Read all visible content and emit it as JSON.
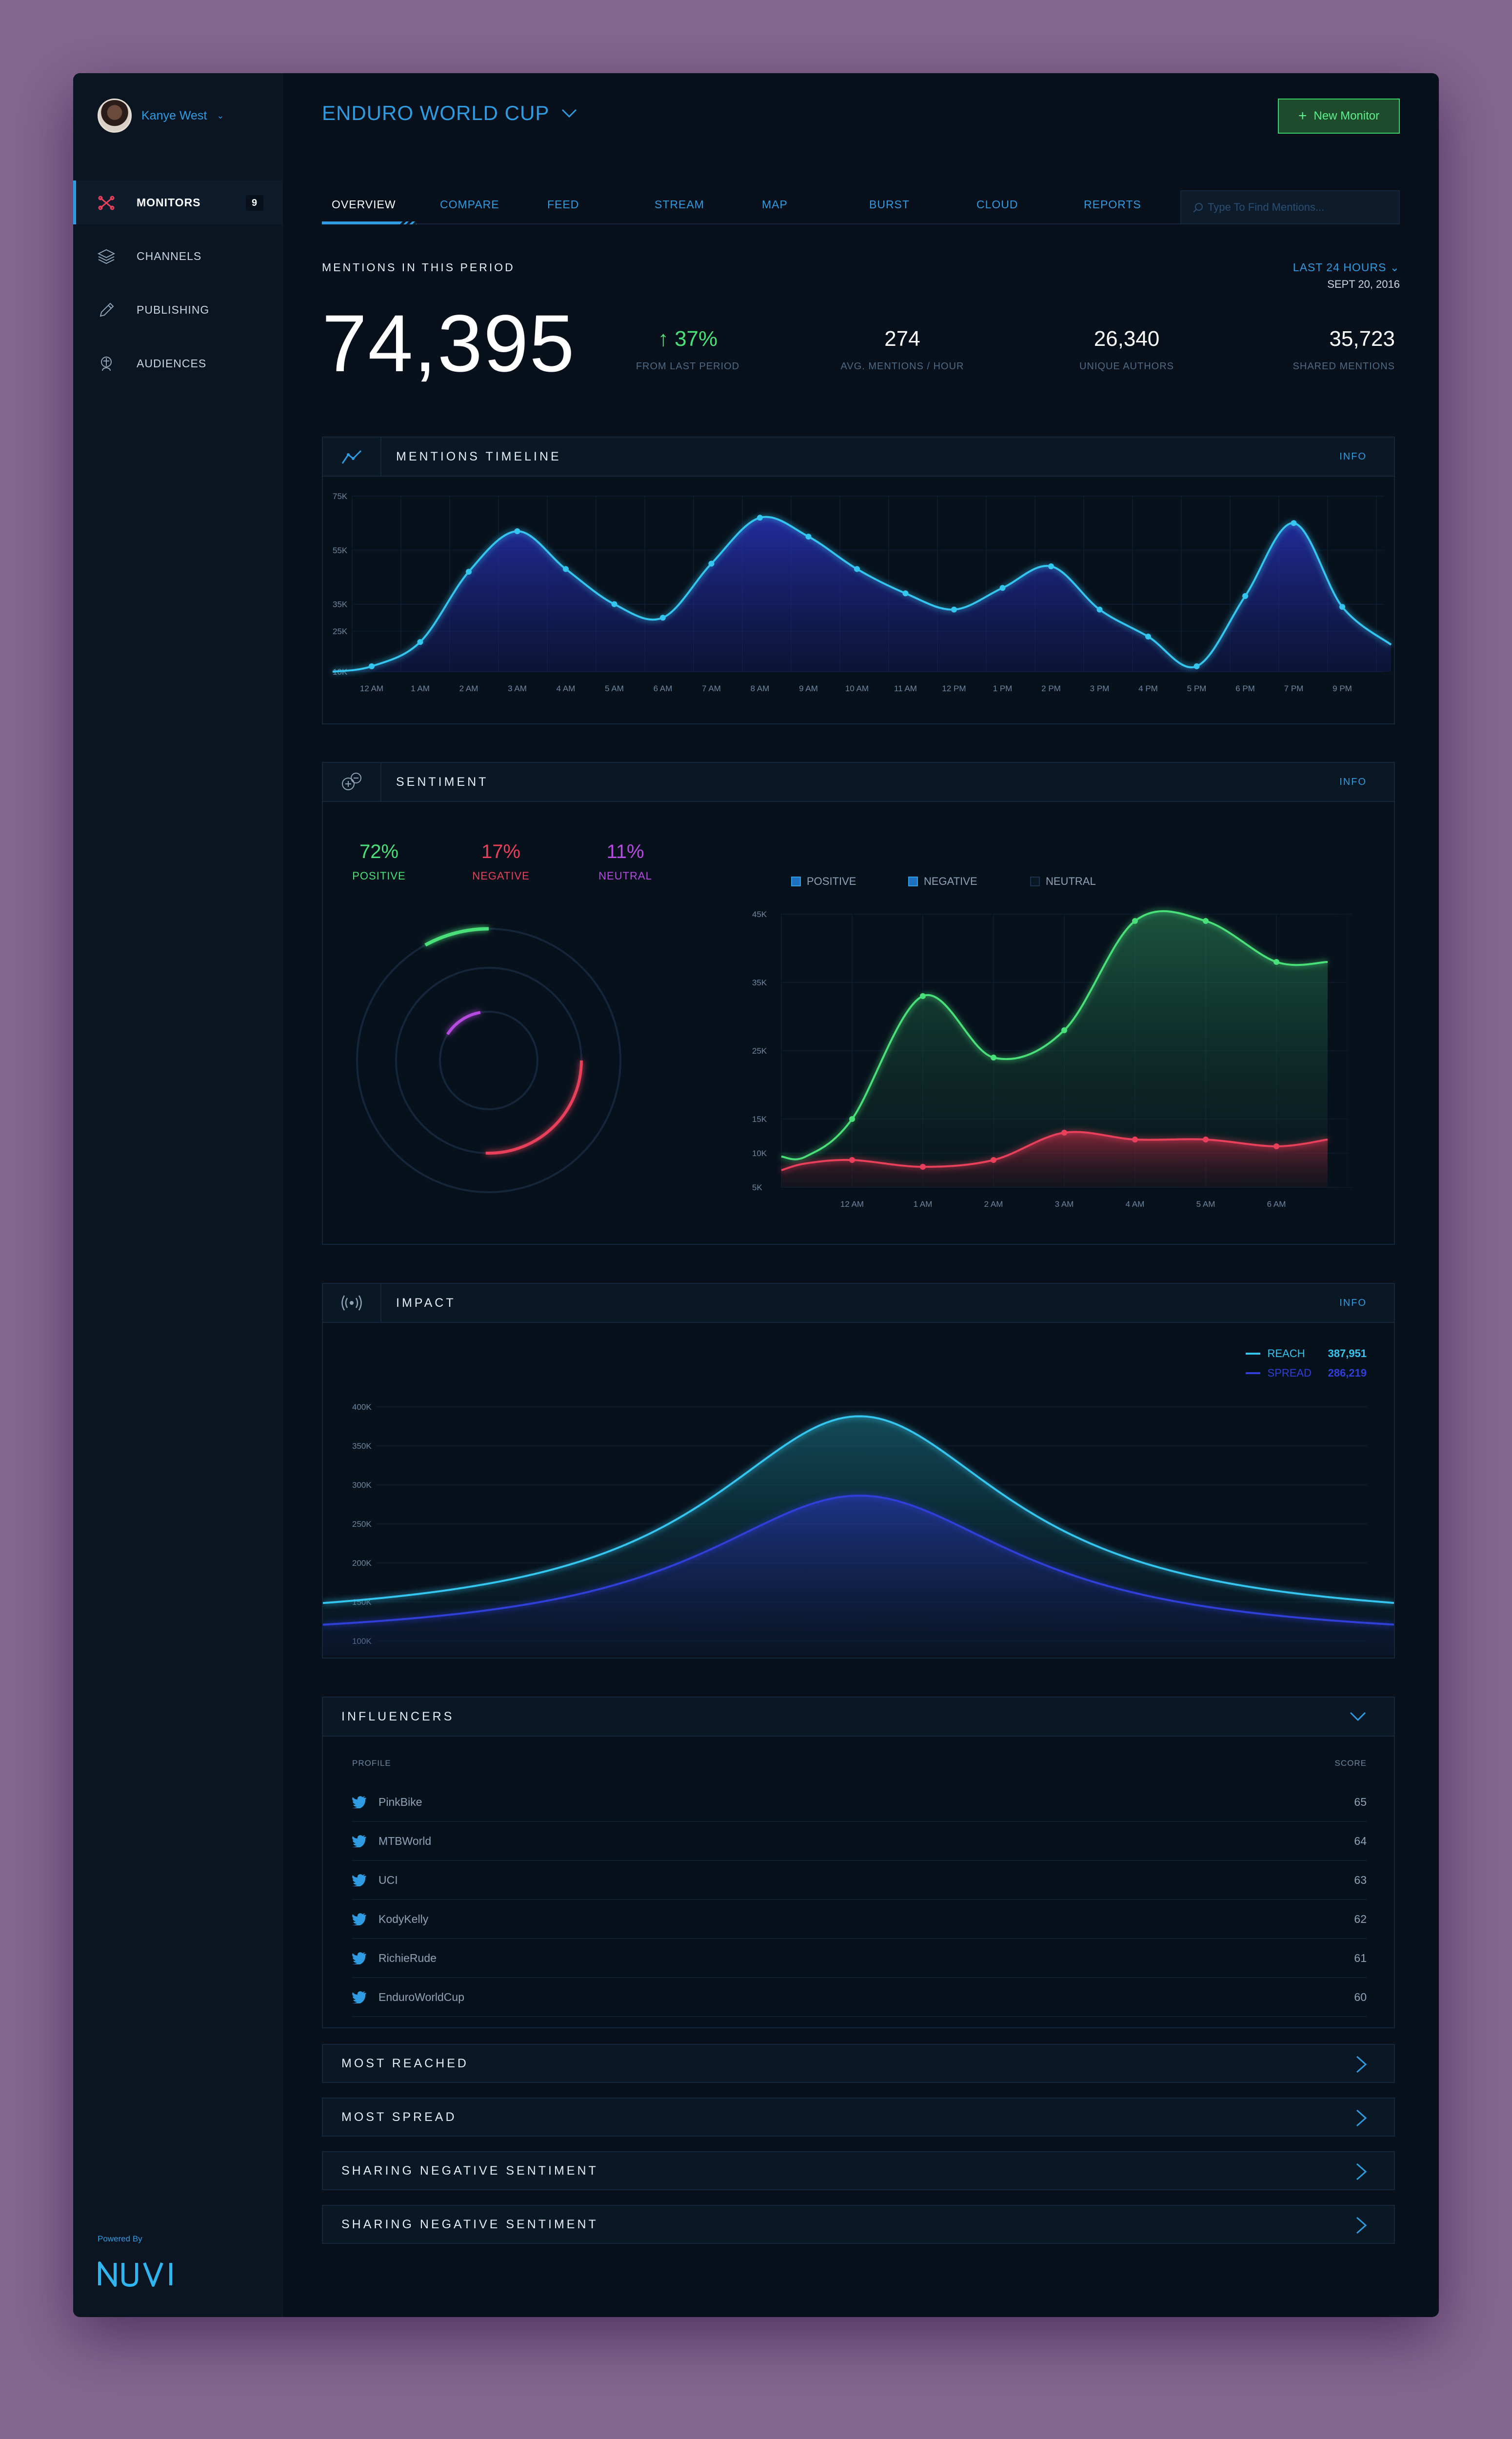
{
  "user": {
    "name": "Kanye West"
  },
  "nav": [
    {
      "label": "MONITORS",
      "badge": "9",
      "icon": "monitors-icon"
    },
    {
      "label": "CHANNELS",
      "icon": "layers-icon"
    },
    {
      "label": "PUBLISHING",
      "icon": "pencil-icon"
    },
    {
      "label": "AUDIENCES",
      "icon": "audience-icon"
    }
  ],
  "powered_by": "Powered By",
  "brand": "NUVI",
  "header": {
    "title": "ENDURO WORLD CUP",
    "new_button": "New Monitor"
  },
  "tabs": [
    "OVERVIEW",
    "COMPARE",
    "FEED",
    "STREAM",
    "MAP",
    "BURST",
    "CLOUD",
    "REPORTS"
  ],
  "search": {
    "placeholder": "Type To Find Mentions..."
  },
  "period": {
    "label": "MENTIONS IN THIS PERIOD",
    "range": "LAST 24 HOURS",
    "date": "SEPT 20, 2016"
  },
  "stats": {
    "total": "74,395",
    "change": {
      "value": "37%",
      "label": "FROM LAST PERIOD"
    },
    "avg": {
      "value": "274",
      "label": "AVG. MENTIONS / HOUR"
    },
    "authors": {
      "value": "26,340",
      "label": "UNIQUE AUTHORS"
    },
    "shared": {
      "value": "35,723",
      "label": "SHARED MENTIONS"
    }
  },
  "timeline": {
    "title": "MENTIONS TIMELINE",
    "info": "INFO"
  },
  "sentiment": {
    "title": "SENTIMENT",
    "info": "INFO",
    "positive": {
      "value": "72%",
      "label": "POSITIVE"
    },
    "negative": {
      "value": "17%",
      "label": "NEGATIVE"
    },
    "neutral": {
      "value": "11%",
      "label": "NEUTRAL"
    },
    "legend": [
      "POSITIVE",
      "NEGATIVE",
      "NEUTRAL"
    ]
  },
  "impact": {
    "title": "IMPACT",
    "info": "INFO",
    "reach": {
      "label": "REACH",
      "value": "387,951"
    },
    "spread": {
      "label": "SPREAD",
      "value": "286,219"
    }
  },
  "influencers": {
    "title": "INFLUENCERS",
    "col_profile": "PROFILE",
    "col_score": "SCORE",
    "rows": [
      {
        "name": "PinkBike",
        "score": "65"
      },
      {
        "name": "MTBWorld",
        "score": "64"
      },
      {
        "name": "UCI",
        "score": "63"
      },
      {
        "name": "KodyKelly",
        "score": "62"
      },
      {
        "name": "RichieRude",
        "score": "61"
      },
      {
        "name": "EnduroWorldCup",
        "score": "60"
      }
    ]
  },
  "collapsibles": [
    "MOST REACHED",
    "MOST SPREAD",
    "SHARING NEGATIVE SENTIMENT",
    "SHARING NEGATIVE SENTIMENT"
  ],
  "colors": {
    "accent": "#2f9be0",
    "positive": "#49e07a",
    "negative": "#e8405a",
    "neutral": "#b64be0",
    "reach": "#35c6f0",
    "spread": "#2f3fd8"
  },
  "chart_data": [
    {
      "type": "area",
      "title": "MENTIONS TIMELINE",
      "x": [
        "12 AM",
        "1 AM",
        "2 AM",
        "3 AM",
        "4 AM",
        "5 AM",
        "6 AM",
        "7 AM",
        "8 AM",
        "9 AM",
        "10 AM",
        "11 AM",
        "12 PM",
        "1 PM",
        "2 PM",
        "3 PM",
        "4 PM",
        "5 PM",
        "6 PM",
        "7 PM",
        "9 PM"
      ],
      "values": [
        12000,
        21000,
        47000,
        62000,
        48000,
        35000,
        30000,
        50000,
        67000,
        60000,
        48000,
        39000,
        33000,
        41000,
        49000,
        33000,
        23000,
        12000,
        38000,
        65000,
        34000
      ],
      "yticks": [
        "10K",
        "25K",
        "35K",
        "55K",
        "75K"
      ],
      "ylim": [
        10000,
        75000
      ]
    },
    {
      "type": "area",
      "title": "SENTIMENT",
      "x": [
        "12 AM",
        "1 AM",
        "2 AM",
        "3 AM",
        "4 AM",
        "5 AM",
        "6 AM"
      ],
      "series": [
        {
          "name": "POSITIVE",
          "values": [
            15000,
            33000,
            24000,
            28000,
            44000,
            44000,
            38000
          ]
        },
        {
          "name": "NEGATIVE",
          "values": [
            9000,
            8000,
            9000,
            13000,
            12000,
            12000,
            11000
          ]
        }
      ],
      "yticks": [
        "5K",
        "10K",
        "15K",
        "25K",
        "35K",
        "45K"
      ],
      "ylim": [
        5000,
        45000
      ]
    },
    {
      "type": "area",
      "title": "IMPACT",
      "series": [
        {
          "name": "REACH",
          "peak": 387951
        },
        {
          "name": "SPREAD",
          "peak": 286219
        }
      ],
      "yticks": [
        "100K",
        "150K",
        "200K",
        "250K",
        "300K",
        "350K",
        "400K"
      ],
      "ylim": [
        100000,
        400000
      ]
    }
  ]
}
